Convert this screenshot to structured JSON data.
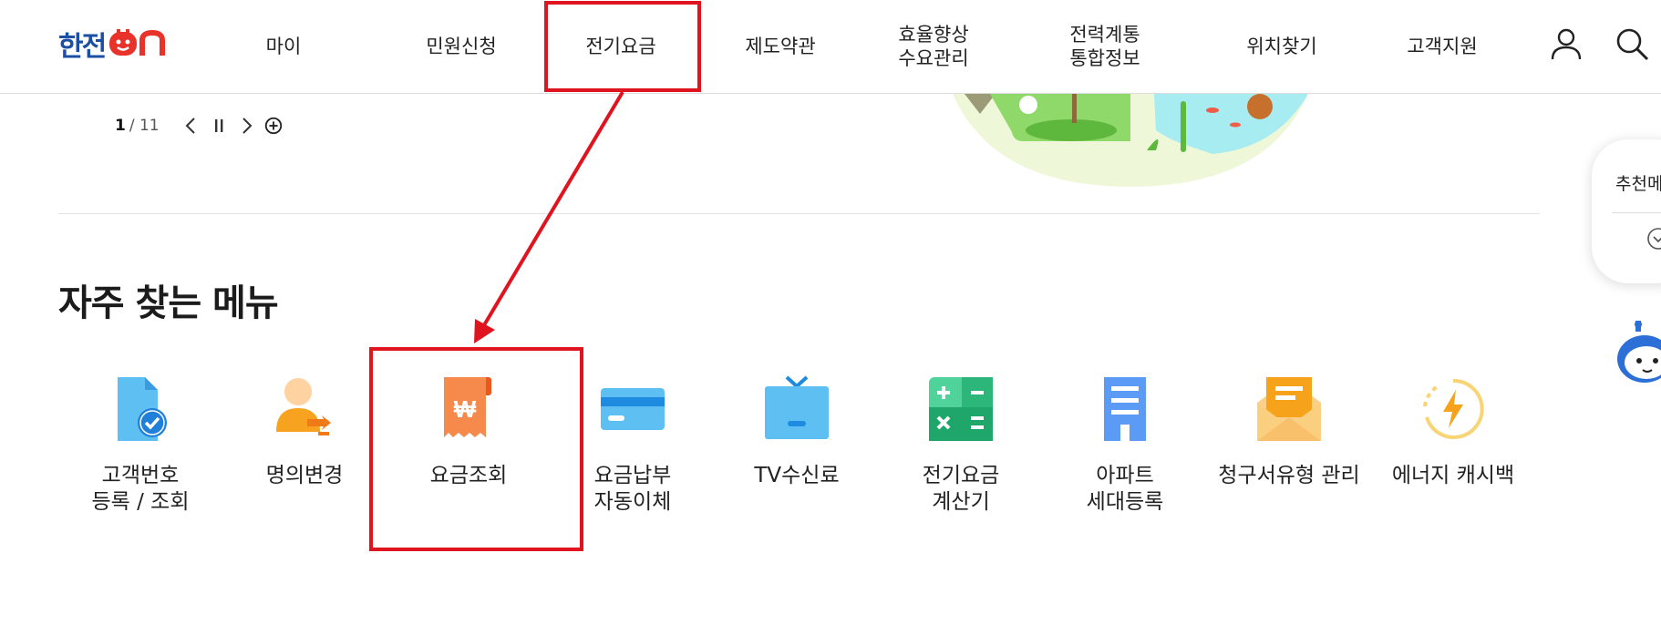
{
  "header": {
    "logo_text": "한전",
    "nav": [
      {
        "label": "마이"
      },
      {
        "label": "민원신청"
      },
      {
        "label": "전기요금"
      },
      {
        "label": "제도약관"
      },
      {
        "label": "효율향상\n수요관리"
      },
      {
        "label": "전력계통\n통합정보"
      },
      {
        "label": "위치찾기"
      },
      {
        "label": "고객지원"
      }
    ],
    "icons": [
      "user-icon",
      "search-icon"
    ]
  },
  "slider": {
    "current": "1",
    "total": "/ 11"
  },
  "section": {
    "title": "자주 찾는 메뉴"
  },
  "menu": [
    {
      "label": "고객번호\n등록 / 조회",
      "icon": "document-check-icon"
    },
    {
      "label": "명의변경",
      "icon": "person-transfer-icon"
    },
    {
      "label": "요금조회",
      "icon": "won-receipt-icon"
    },
    {
      "label": "요금납부\n자동이체",
      "icon": "credit-card-icon"
    },
    {
      "label": "TV수신료",
      "icon": "tv-icon"
    },
    {
      "label": "전기요금\n계산기",
      "icon": "calculator-icon"
    },
    {
      "label": "아파트\n세대등록",
      "icon": "building-icon"
    },
    {
      "label": "청구서유형 관리",
      "icon": "mail-icon"
    },
    {
      "label": "에너지 캐시백",
      "icon": "energy-bolt-icon"
    }
  ],
  "side": {
    "label": "추천메뉴"
  },
  "colors": {
    "highlight": "#e0141e",
    "brand_blue": "#1a4fa3",
    "brand_red": "#e8332a"
  }
}
